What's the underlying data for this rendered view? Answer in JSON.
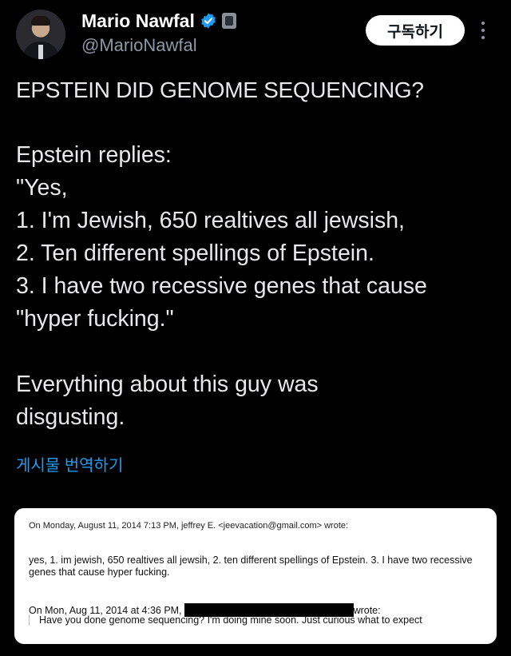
{
  "author": {
    "name": "Mario Nawfal",
    "handle": "@MarioNawfal"
  },
  "actions": {
    "subscribe_label": "구독하기"
  },
  "post": {
    "headline": "EPSTEIN DID GENOME SEQUENCING?",
    "lines": [
      "Epstein replies:",
      "\"Yes,",
      "1. I'm Jewish, 650 realtives all jewsish,",
      "2. Ten different spellings of Epstein.",
      "3. I have two recessive genes that cause",
      "\"hyper fucking.\""
    ],
    "closing": "Everything about this guy was\ndisgusting.",
    "translate_label": "게시물 번역하기"
  },
  "email": {
    "header": "On Monday, August 11, 2014 7:13 PM, jeffrey E. <jeevacation@gmail.com> wrote:",
    "reply": "yes, 1.  im jewish,  650 realtives all jewsih, 2.  ten different spellings of Epstein.  3.  I have two recessive genes that cause hyper fucking.",
    "quoted_head_prefix": "On Mon, Aug 11, 2014 at 4:36 PM,",
    "quoted_head_suffix": "wrote:",
    "quoted_body": "Have you done genome sequencing? I'm doing mine soon. Just curious what to expect"
  },
  "colors": {
    "background": "#000000",
    "text": "#e7e9ea",
    "secondary": "#8b98a5",
    "link": "#1d9bf0",
    "verified": "#1d9bf0"
  },
  "icons": [
    "verified-badge-icon",
    "affiliate-badge-icon",
    "more-options-icon"
  ]
}
